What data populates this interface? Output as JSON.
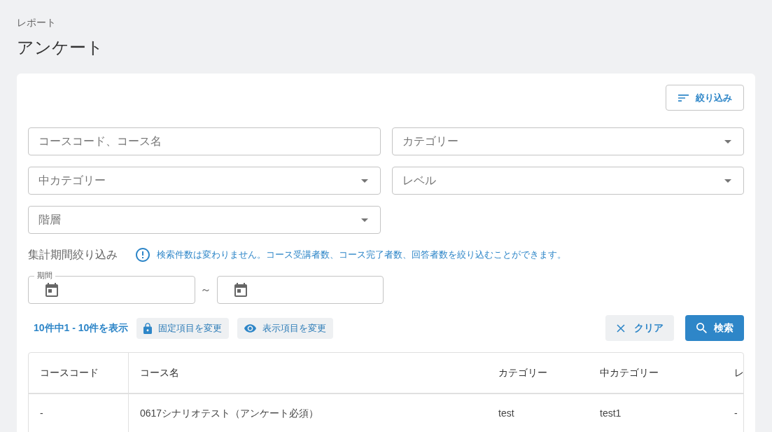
{
  "breadcrumb": "レポート",
  "title": "アンケート",
  "filter_button": {
    "label": "絞り込み"
  },
  "fields": [
    {
      "kind": "text",
      "placeholder": "コースコード、コース名"
    },
    {
      "kind": "select",
      "label": "カテゴリー"
    },
    {
      "kind": "select",
      "label": "中カテゴリー"
    },
    {
      "kind": "select",
      "label": "レベル"
    },
    {
      "kind": "select",
      "label": "階層"
    }
  ],
  "period": {
    "label": "集計期間絞り込み",
    "note": "検索件数は変わりません。コース受講者数、コース完了者数、回答者数を絞り込むことができます。",
    "field_label": "期間",
    "separator": "～"
  },
  "toolbar": {
    "count": "10件中1 - 10件を表示",
    "buttons": [
      {
        "kind": "lock",
        "label": "固定項目を変更"
      },
      {
        "kind": "eye",
        "label": "表示項目を変更"
      }
    ],
    "clear_button": "クリア",
    "search_button": "検索"
  },
  "table": {
    "columns": [
      "コースコード",
      "コース名",
      "カテゴリー",
      "中カテゴリー",
      "レ"
    ],
    "rows": [
      [
        "-",
        "0617シナリオテスト（アンケート必須）",
        "test",
        "test1",
        "-"
      ]
    ]
  }
}
